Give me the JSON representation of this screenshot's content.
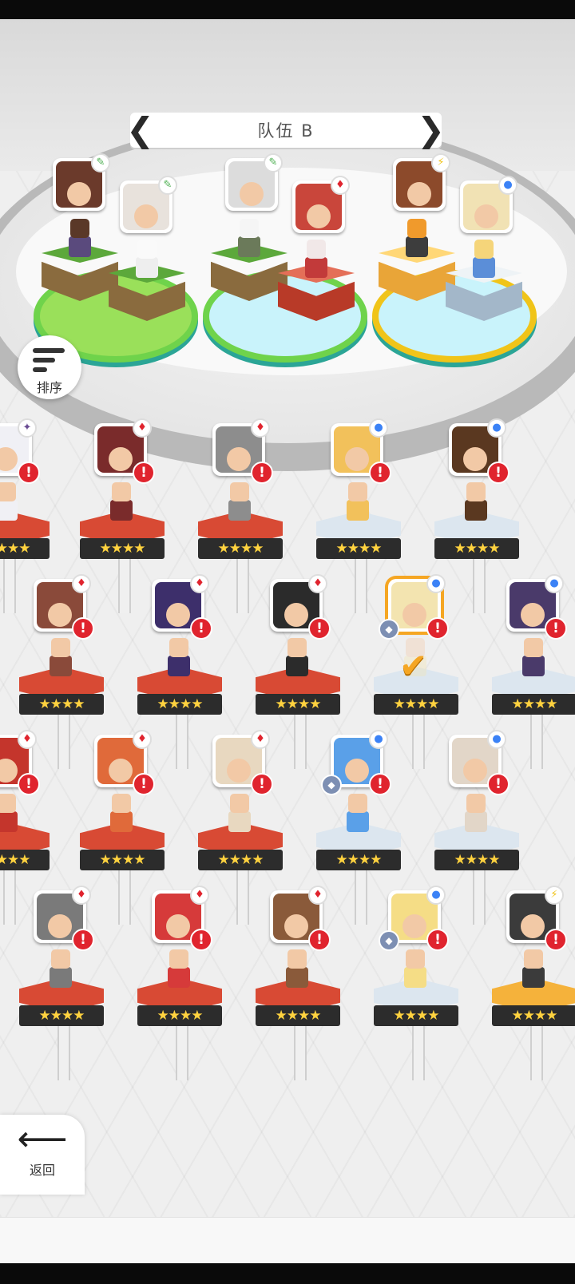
{
  "team": {
    "title": "队伍 B",
    "prev_icon": "chevron-left-icon",
    "next_icon": "chevron-right-icon"
  },
  "buttons": {
    "sort_label": "排序",
    "back_label": "返回",
    "sort_icon": "sort-descending-icon",
    "back_icon": "arrow-left-icon"
  },
  "stars": "★★★★",
  "colors": {
    "alert": "#e0242e",
    "selected": "#f5a623",
    "ring_green": "#6fd34b",
    "ring_gold": "#f0c419"
  },
  "team_slots": [
    {
      "element": "nature",
      "ring": "green"
    },
    {
      "element": "nature",
      "ring": "green"
    },
    {
      "element": "fire",
      "ring": "gold"
    }
  ],
  "heroes": [
    {
      "element": "dark",
      "stars": 4,
      "alert": true
    },
    {
      "element": "fire",
      "stars": 4,
      "alert": true
    },
    {
      "element": "fire",
      "stars": 4,
      "alert": true
    },
    {
      "element": "water",
      "stars": 4,
      "alert": true
    },
    {
      "element": "water",
      "stars": 4,
      "alert": true
    },
    {
      "element": "fire",
      "stars": 4,
      "alert": true
    },
    {
      "element": "fire",
      "stars": 4,
      "alert": true
    },
    {
      "element": "fire",
      "stars": 4,
      "alert": true
    },
    {
      "element": "water",
      "stars": 4,
      "alert": true,
      "selected": true
    },
    {
      "element": "water",
      "stars": 4,
      "alert": true
    },
    {
      "element": "fire",
      "stars": 4,
      "alert": true
    },
    {
      "element": "fire",
      "stars": 4,
      "alert": true
    },
    {
      "element": "fire",
      "stars": 4,
      "alert": true
    },
    {
      "element": "water",
      "stars": 4,
      "alert": true
    },
    {
      "element": "water",
      "stars": 4,
      "alert": true
    },
    {
      "element": "fire",
      "stars": 4,
      "alert": true
    },
    {
      "element": "fire",
      "stars": 4,
      "alert": true
    },
    {
      "element": "fire",
      "stars": 4,
      "alert": true
    },
    {
      "element": "water",
      "stars": 4,
      "alert": true
    },
    {
      "element": "light",
      "stars": 4,
      "alert": true
    }
  ]
}
